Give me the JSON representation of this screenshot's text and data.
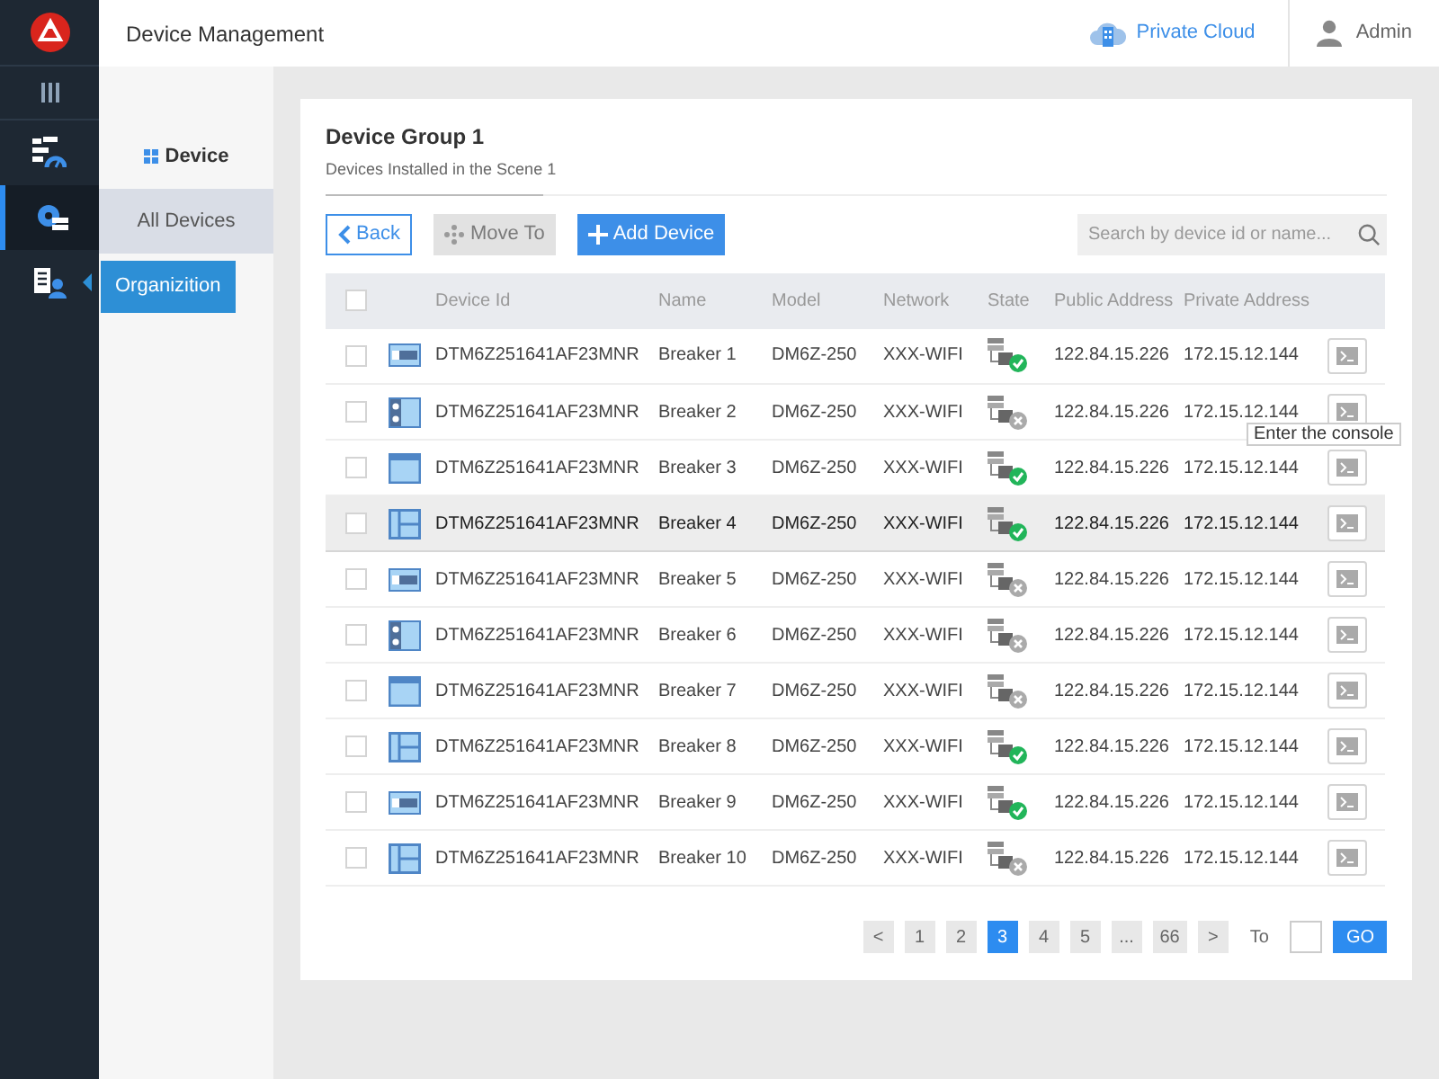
{
  "header": {
    "title": "Device Management",
    "cloud": "Private Cloud",
    "user": "Admin"
  },
  "sidebar": {
    "items": [
      {
        "kind": "dashboard",
        "selected": false
      },
      {
        "kind": "devices",
        "selected": true
      },
      {
        "kind": "organization",
        "selected": false,
        "tooltip": "Organizition"
      }
    ]
  },
  "subnav": {
    "heading": "Device",
    "items": [
      {
        "label": "All Devices",
        "selected": true
      }
    ]
  },
  "group": {
    "title": "Device Group 1",
    "subtitle": "Devices Installed in the Scene 1"
  },
  "toolbar": {
    "back": "Back",
    "move": {
      "label": "Move To",
      "disabled": true
    },
    "add": "Add Device",
    "search": {
      "placeholder": "Search by device id or name..."
    }
  },
  "table": {
    "all_checked": false,
    "columns": [
      "Device Id",
      "Name",
      "Model",
      "Network",
      "State",
      "Public Address",
      "Private Address"
    ],
    "rows": [
      {
        "kind": "bar",
        "id": "DTM6Z251641AF23MNR",
        "name": "Breaker 1",
        "model": "DM6Z-250",
        "network": "XXX-WIFI",
        "online": true,
        "public": "122.84.15.226",
        "private": "172.15.12.144",
        "checked": false,
        "highlighted": false
      },
      {
        "kind": "dots",
        "id": "DTM6Z251641AF23MNR",
        "name": "Breaker 2",
        "model": "DM6Z-250",
        "network": "XXX-WIFI",
        "online": false,
        "public": "122.84.15.226",
        "private": "172.15.12.144",
        "checked": false,
        "highlighted": false,
        "tooltip": "Enter the console"
      },
      {
        "kind": "header",
        "id": "DTM6Z251641AF23MNR",
        "name": "Breaker 3",
        "model": "DM6Z-250",
        "network": "XXX-WIFI",
        "online": true,
        "public": "122.84.15.226",
        "private": "172.15.12.144",
        "checked": false,
        "highlighted": false
      },
      {
        "kind": "split",
        "id": "DTM6Z251641AF23MNR",
        "name": "Breaker 4",
        "model": "DM6Z-250",
        "network": "XXX-WIFI",
        "online": true,
        "public": "122.84.15.226",
        "private": "172.15.12.144",
        "checked": false,
        "highlighted": true
      },
      {
        "kind": "bar",
        "id": "DTM6Z251641AF23MNR",
        "name": "Breaker 5",
        "model": "DM6Z-250",
        "network": "XXX-WIFI",
        "online": false,
        "public": "122.84.15.226",
        "private": "172.15.12.144",
        "checked": false,
        "highlighted": false
      },
      {
        "kind": "dots",
        "id": "DTM6Z251641AF23MNR",
        "name": "Breaker 6",
        "model": "DM6Z-250",
        "network": "XXX-WIFI",
        "online": false,
        "public": "122.84.15.226",
        "private": "172.15.12.144",
        "checked": false,
        "highlighted": false
      },
      {
        "kind": "header",
        "id": "DTM6Z251641AF23MNR",
        "name": "Breaker 7",
        "model": "DM6Z-250",
        "network": "XXX-WIFI",
        "online": false,
        "public": "122.84.15.226",
        "private": "172.15.12.144",
        "checked": false,
        "highlighted": false
      },
      {
        "kind": "split",
        "id": "DTM6Z251641AF23MNR",
        "name": "Breaker 8",
        "model": "DM6Z-250",
        "network": "XXX-WIFI",
        "online": true,
        "public": "122.84.15.226",
        "private": "172.15.12.144",
        "checked": false,
        "highlighted": false
      },
      {
        "kind": "bar",
        "id": "DTM6Z251641AF23MNR",
        "name": "Breaker 9",
        "model": "DM6Z-250",
        "network": "XXX-WIFI",
        "online": true,
        "public": "122.84.15.226",
        "private": "172.15.12.144",
        "checked": false,
        "highlighted": false
      },
      {
        "kind": "split",
        "id": "DTM6Z251641AF23MNR",
        "name": "Breaker 10",
        "model": "DM6Z-250",
        "network": "XXX-WIFI",
        "online": false,
        "public": "122.84.15.226",
        "private": "172.15.12.144",
        "checked": false,
        "highlighted": false
      }
    ]
  },
  "pagination": {
    "pages": [
      {
        "label": "1",
        "selected": false
      },
      {
        "label": "2",
        "selected": false
      },
      {
        "label": "3",
        "selected": true
      },
      {
        "label": "4",
        "selected": false
      },
      {
        "label": "5",
        "selected": false
      },
      {
        "label": "...",
        "selected": false
      },
      {
        "label": "66",
        "selected": false
      }
    ],
    "prev": "<",
    "next": ">",
    "to": "To",
    "go": "GO"
  }
}
